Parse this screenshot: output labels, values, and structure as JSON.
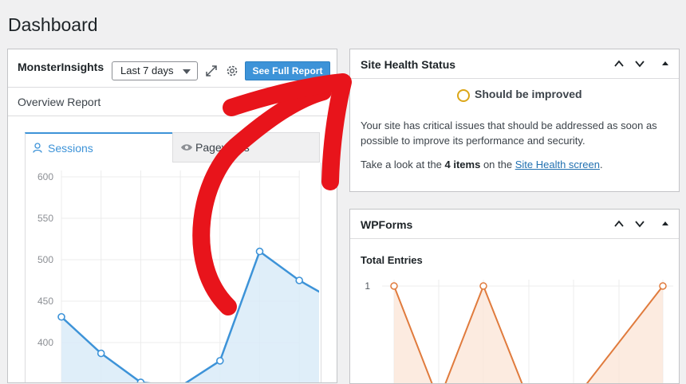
{
  "page": {
    "title": "Dashboard"
  },
  "monsterinsights": {
    "title": "MonsterInsights",
    "period": "Last 7 days",
    "full_report": "See Full Report",
    "overview": "Overview Report",
    "tabs": [
      {
        "label": "Sessions"
      },
      {
        "label": "Pageviews"
      }
    ]
  },
  "site_health": {
    "title": "Site Health Status",
    "status": "Should be improved",
    "description": "Your site has critical issues that should be addressed as soon as possible to improve its performance and security.",
    "take_prefix": "Take a look at the ",
    "take_count": "4 items",
    "take_middle": " on the ",
    "take_link": "Site Health screen",
    "take_suffix": "."
  },
  "wpforms": {
    "title": "WPForms",
    "subtitle": "Total Entries"
  },
  "colors": {
    "accent": "#3d93d8",
    "warning": "#dba617",
    "arrow": "#e8141b",
    "wpforms_line": "#e07b3d"
  },
  "chart_data": [
    {
      "type": "area",
      "xlabel": "",
      "ylabel": "",
      "ylim": [
        360,
        600
      ],
      "yticks": [
        400,
        450,
        500,
        550,
        600
      ],
      "points": [
        431,
        387,
        352,
        347,
        378,
        510,
        475,
        448
      ],
      "grid": true
    },
    {
      "type": "line",
      "title": "Total Entries",
      "yticks": [
        1
      ],
      "ylim": [
        0,
        1
      ],
      "points": [
        1,
        0,
        1,
        0,
        0,
        1
      ],
      "grid": true
    }
  ]
}
